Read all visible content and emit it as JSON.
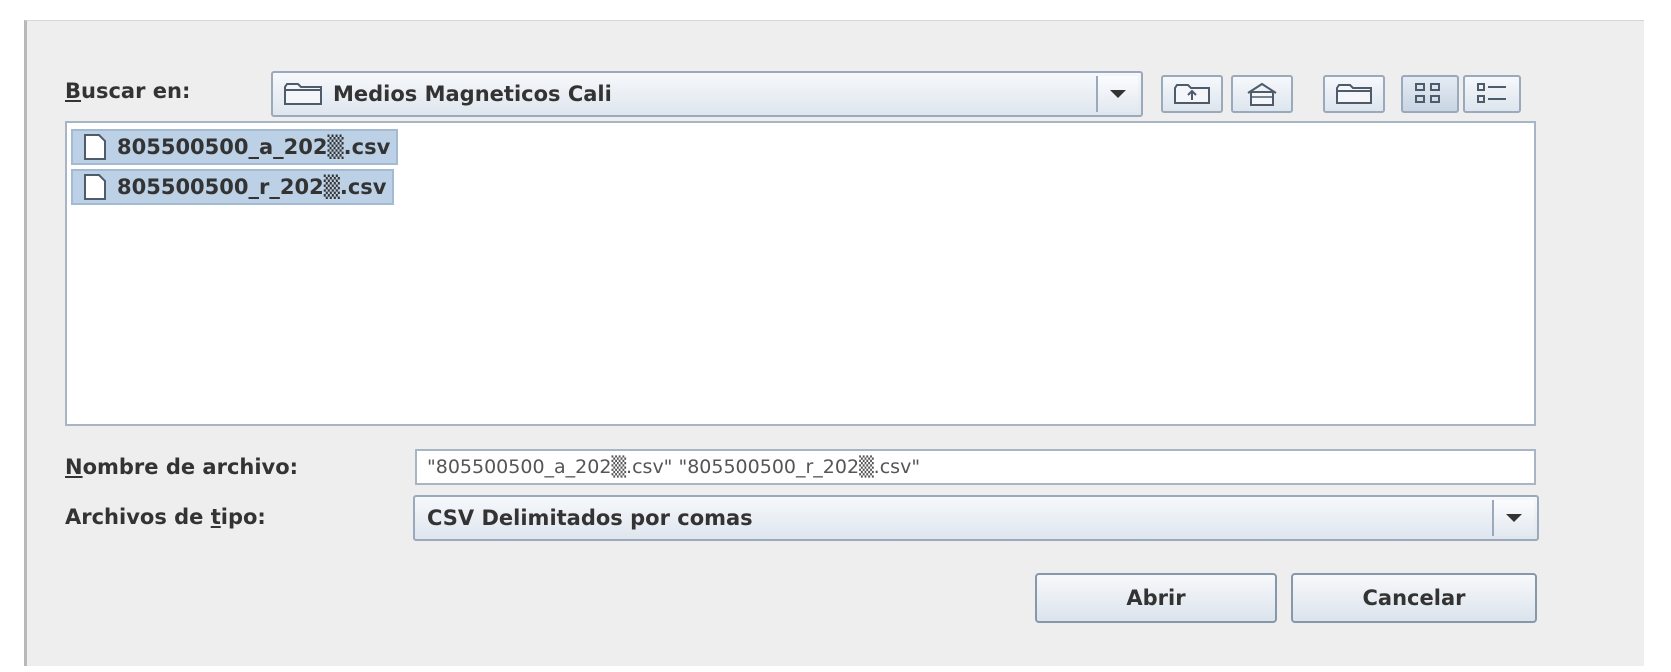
{
  "look_in": {
    "label_prefix": "",
    "label_mnemonic": "B",
    "label_rest": "uscar en:",
    "folder": "Medios Magneticos Cali"
  },
  "toolbar": {
    "icons": [
      "up-folder-icon",
      "home-icon",
      "new-folder-icon",
      "list-view-icon",
      "details-view-icon"
    ]
  },
  "files": [
    {
      "name": "805500500_a_202▒.csv",
      "selected": true
    },
    {
      "name": "805500500_r_202▒.csv",
      "selected": true
    }
  ],
  "filename": {
    "label_mnemonic": "N",
    "label_rest": "ombre de archivo:",
    "value": "\"805500500_a_202▒.csv\" \"805500500_r_202▒.csv\""
  },
  "filetype": {
    "label_prefix": "Archivos de ",
    "label_mnemonic": "t",
    "label_rest": "ipo:",
    "value": "CSV Delimitados por comas"
  },
  "buttons": {
    "open": "Abrir",
    "cancel": "Cancelar"
  },
  "colors": {
    "selection": "#bcd0e6",
    "border": "#9aa9bb",
    "dialog_bg": "#eeeeee"
  }
}
